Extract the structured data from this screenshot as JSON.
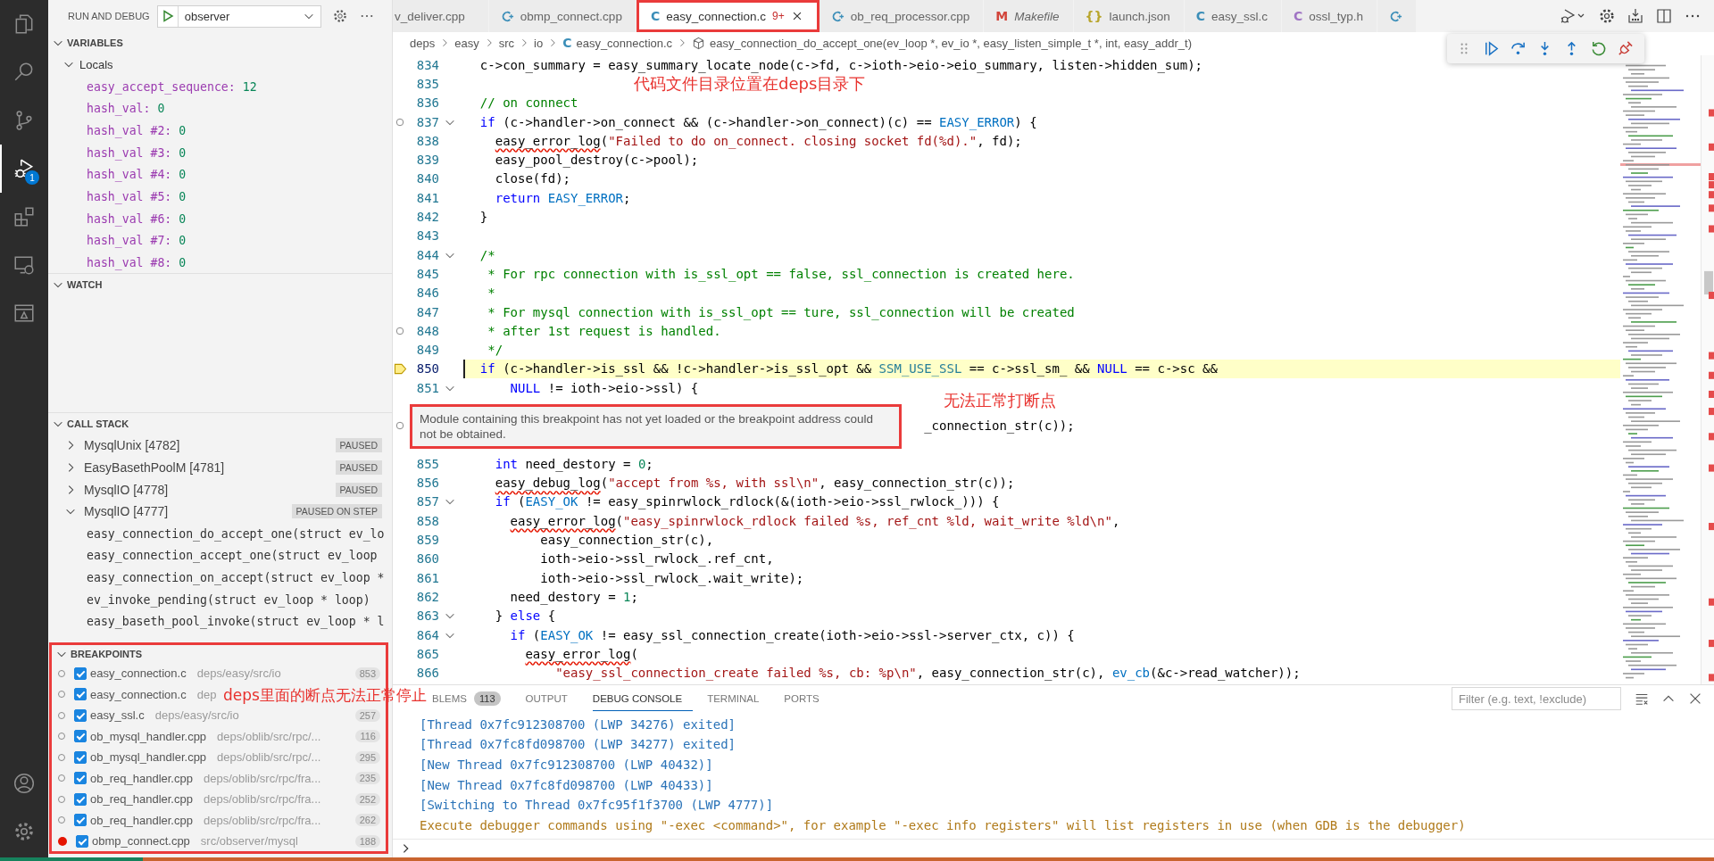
{
  "activity_bar": {
    "items": [
      {
        "kind": "files",
        "selected": false
      },
      {
        "kind": "search",
        "selected": false
      },
      {
        "kind": "source-control",
        "selected": false
      },
      {
        "kind": "debug",
        "selected": true,
        "badge": "1"
      },
      {
        "kind": "extensions",
        "selected": false
      },
      {
        "kind": "remote",
        "selected": false
      },
      {
        "kind": "panel",
        "selected": false
      }
    ],
    "bottom": [
      {
        "kind": "account"
      },
      {
        "kind": "manage"
      }
    ]
  },
  "sidebar": {
    "title": "RUN AND DEBUG",
    "config": "observer",
    "variables": {
      "title": "VARIABLES",
      "expanded": true,
      "scope": {
        "label": "Locals",
        "expanded": true,
        "items": [
          {
            "name": "easy_accept_sequence:",
            "value": "12"
          },
          {
            "name": "hash_val:",
            "value": "0"
          },
          {
            "name": "hash_val #2:",
            "value": "0"
          },
          {
            "name": "hash_val #3:",
            "value": "0"
          },
          {
            "name": "hash_val #4:",
            "value": "0"
          },
          {
            "name": "hash_val #5:",
            "value": "0"
          },
          {
            "name": "hash_val #6:",
            "value": "0"
          },
          {
            "name": "hash_val #7:",
            "value": "0"
          },
          {
            "name": "hash_val #8:",
            "value": "0"
          }
        ]
      }
    },
    "watch": {
      "title": "WATCH",
      "expanded": true
    },
    "call_stack": {
      "title": "CALL STACK",
      "expanded": true,
      "threads": [
        {
          "name": "MysqlUnix [4782]",
          "status": "PAUSED",
          "expanded": false
        },
        {
          "name": "EasyBasethPoolM [4781]",
          "status": "PAUSED",
          "expanded": false
        },
        {
          "name": "MysqlIO [4778]",
          "status": "PAUSED",
          "expanded": false
        },
        {
          "name": "MysqlIO [4777]",
          "status": "PAUSED ON STEP",
          "expanded": true,
          "frames": [
            "easy_connection_do_accept_one(struct ev_lo",
            "easy_connection_accept_one(struct ev_loop",
            "easy_connection_on_accept(struct ev_loop *",
            "ev_invoke_pending(struct ev_loop * loop)",
            "easy_baseth_pool_invoke(struct ev_loop * l"
          ]
        }
      ]
    },
    "breakpoints": {
      "title": "BREAKPOINTS",
      "expanded": true,
      "annotated": true,
      "items": [
        {
          "file": "easy_connection.c",
          "path": "deps/easy/src/io",
          "line": "853",
          "verified": false,
          "checked": true
        },
        {
          "file": "easy_connection.c",
          "path": "dep",
          "verified": false,
          "checked": true
        },
        {
          "file": "easy_ssl.c",
          "path": "deps/easy/src/io",
          "line": "257",
          "verified": false,
          "checked": true
        },
        {
          "file": "ob_mysql_handler.cpp",
          "path": "deps/oblib/src/rpc/...",
          "line": "116",
          "verified": false,
          "checked": true
        },
        {
          "file": "ob_mysql_handler.cpp",
          "path": "deps/oblib/src/rpc/...",
          "line": "295",
          "verified": false,
          "checked": true
        },
        {
          "file": "ob_req_handler.cpp",
          "path": "deps/oblib/src/rpc/fra...",
          "line": "235",
          "verified": false,
          "checked": true
        },
        {
          "file": "ob_req_handler.cpp",
          "path": "deps/oblib/src/rpc/fra...",
          "line": "252",
          "verified": false,
          "checked": true
        },
        {
          "file": "ob_req_handler.cpp",
          "path": "deps/oblib/src/rpc/fra...",
          "line": "262",
          "verified": false,
          "checked": true
        },
        {
          "file": "obmp_connect.cpp",
          "path": "src/observer/mysql",
          "line": "188",
          "verified": true,
          "checked": true
        }
      ]
    }
  },
  "editor": {
    "tabs": [
      {
        "label": "v_deliver.cpp",
        "selected": false,
        "preview": false,
        "annotated": false
      },
      {
        "label": "obmp_connect.cpp",
        "icon": {
          "kind": "cpp"
        },
        "selected": false,
        "preview": false,
        "annotated": false
      },
      {
        "label": "easy_connection.c",
        "icon": {
          "kind": "c",
          "glyph": "C"
        },
        "badge": "9+",
        "selected": true,
        "preview": false,
        "annotated": true
      },
      {
        "label": "ob_req_processor.cpp",
        "icon": {
          "kind": "cpp"
        },
        "selected": false,
        "preview": false,
        "annotated": false
      },
      {
        "label": "Makefile",
        "icon": {
          "kind": "make",
          "glyph": "M"
        },
        "selected": false,
        "preview": true,
        "annotated": false
      },
      {
        "label": "launch.json",
        "icon": {
          "kind": "json",
          "glyph": "{}"
        },
        "selected": false,
        "preview": false,
        "annotated": false
      },
      {
        "label": "easy_ssl.c",
        "icon": {
          "kind": "c",
          "glyph": "C"
        },
        "selected": false,
        "preview": false,
        "annotated": false
      },
      {
        "label": "ossl_typ.h",
        "icon": {
          "kind": "h",
          "glyph": "C"
        },
        "selected": false,
        "preview": false,
        "annotated": false
      },
      {
        "icon": {
          "kind": "cpp"
        },
        "selected": false,
        "annotated": false
      }
    ],
    "actions": [
      {
        "kind": "run-debug"
      },
      {
        "kind": "settings"
      },
      {
        "kind": "tray"
      },
      {
        "kind": "split"
      },
      {
        "kind": "more"
      }
    ],
    "breadcrumb": [
      {
        "label": "deps"
      },
      {
        "label": "easy"
      },
      {
        "label": "src"
      },
      {
        "label": "io"
      },
      {
        "label": "easy_connection.c",
        "icon": {
          "kind": "c",
          "glyph": "C"
        }
      },
      {
        "label": "easy_connection_do_accept_one(ev_loop *, ev_io *, easy_listen_simple_t *, int, easy_addr_t)",
        "icon": {
          "kind": "method"
        }
      }
    ],
    "debug_toolbar": [
      {
        "kind": "grip"
      },
      {
        "kind": "continue"
      },
      {
        "kind": "step-over"
      },
      {
        "kind": "step-into"
      },
      {
        "kind": "step-out"
      },
      {
        "kind": "restart"
      },
      {
        "kind": "disconnect"
      }
    ],
    "lines": [
      {
        "n": "834",
        "breakpoint": false,
        "current": false,
        "fold": false,
        "segments": [
          {
            "kind": "plain",
            "text": "  c->con_summary = easy_summary_locate_node(c->fd, c->ioth->eio->eio_summary, listen->hidden_sum);"
          }
        ]
      },
      {
        "n": "835",
        "breakpoint": false,
        "current": false,
        "fold": false
      },
      {
        "n": "836",
        "breakpoint": false,
        "current": false,
        "fold": false,
        "segments": [
          {
            "kind": "comment",
            "text": "  // on connect"
          }
        ]
      },
      {
        "n": "837",
        "breakpoint": true,
        "current": false,
        "fold": true,
        "segments": [
          {
            "kind": "keyword",
            "text": "  if"
          },
          {
            "kind": "plain",
            "text": " (c->handler->on_connect && (c->handler->on_connect)(c) == "
          },
          {
            "kind": "constant",
            "text": "EASY_ERROR"
          },
          {
            "kind": "plain",
            "text": ") {"
          }
        ]
      },
      {
        "n": "838",
        "breakpoint": false,
        "current": false,
        "fold": false,
        "segments": [
          {
            "kind": "flagged",
            "text": "    easy_error_log"
          },
          {
            "kind": "plain",
            "text": "("
          },
          {
            "kind": "string",
            "text": "\"Failed to do on_connect. closing socket fd(%d).\""
          },
          {
            "kind": "plain",
            "text": ", fd);"
          }
        ]
      },
      {
        "n": "839",
        "breakpoint": false,
        "current": false,
        "fold": false,
        "segments": [
          {
            "kind": "plain",
            "text": "    easy_pool_destroy(c->pool);"
          }
        ]
      },
      {
        "n": "840",
        "breakpoint": false,
        "current": false,
        "fold": false,
        "segments": [
          {
            "kind": "plain",
            "text": "    close(fd);"
          }
        ]
      },
      {
        "n": "841",
        "breakpoint": false,
        "current": false,
        "fold": false,
        "segments": [
          {
            "kind": "keyword",
            "text": "    return"
          },
          {
            "kind": "constant",
            "text": " EASY_ERROR"
          },
          {
            "kind": "plain",
            "text": ";"
          }
        ]
      },
      {
        "n": "842",
        "breakpoint": false,
        "current": false,
        "fold": false,
        "segments": [
          {
            "kind": "plain",
            "text": "  }"
          }
        ]
      },
      {
        "n": "843",
        "breakpoint": false,
        "current": false,
        "fold": false
      },
      {
        "n": "844",
        "breakpoint": false,
        "current": false,
        "fold": true,
        "segments": [
          {
            "kind": "comment",
            "text": "  /*"
          }
        ]
      },
      {
        "n": "845",
        "breakpoint": false,
        "current": false,
        "fold": false,
        "segments": [
          {
            "kind": "comment",
            "text": "   * For rpc connection with is_ssl_opt == false, ssl_connection is created here."
          }
        ]
      },
      {
        "n": "846",
        "breakpoint": false,
        "current": false,
        "fold": false,
        "segments": [
          {
            "kind": "comment",
            "text": "   *"
          }
        ]
      },
      {
        "n": "847",
        "breakpoint": false,
        "current": false,
        "fold": false,
        "segments": [
          {
            "kind": "comment",
            "text": "   * For mysql connection with is_ssl_opt == ture, ssl_connection will be created"
          }
        ]
      },
      {
        "n": "848",
        "breakpoint": true,
        "current": false,
        "fold": false,
        "segments": [
          {
            "kind": "comment",
            "text": "   * after 1st request is handled."
          }
        ]
      },
      {
        "n": "849",
        "breakpoint": false,
        "current": false,
        "fold": false,
        "segments": [
          {
            "kind": "comment",
            "text": "   */"
          }
        ]
      },
      {
        "n": "850",
        "breakpoint": false,
        "current": true,
        "fold": false,
        "segments": [
          {
            "kind": "keyword",
            "text": "  if"
          },
          {
            "kind": "plain",
            "text": " (c->handler->is_ssl && !c->handler->is_ssl_opt && "
          },
          {
            "kind": "type",
            "text": "SSM_USE_SSL"
          },
          {
            "kind": "plain",
            "text": " == c->ssl_sm_ && "
          },
          {
            "kind": "keyword",
            "text": "NULL"
          },
          {
            "kind": "plain",
            "text": " == c->sc &&"
          }
        ]
      },
      {
        "n": "851",
        "breakpoint": false,
        "current": false,
        "fold": true,
        "segments": [
          {
            "kind": "keyword",
            "text": "      NULL"
          },
          {
            "kind": "plain",
            "text": " != ioth->eio->ssl) {"
          }
        ]
      },
      {
        "breakpoint": false,
        "current": false,
        "fold": false
      },
      {
        "breakpoint": true,
        "current": false,
        "fold": false,
        "segments": [
          {
            "kind": "plain",
            "text": "                                                             _connection_str(c));"
          }
        ]
      },
      {
        "breakpoint": false,
        "current": false,
        "fold": false
      },
      {
        "n": "855",
        "breakpoint": false,
        "current": false,
        "fold": false,
        "segments": [
          {
            "kind": "keyword",
            "text": "    int"
          },
          {
            "kind": "plain",
            "text": " need_destory = "
          },
          {
            "kind": "number",
            "text": "0"
          },
          {
            "kind": "plain",
            "text": ";"
          }
        ]
      },
      {
        "n": "856",
        "breakpoint": false,
        "current": false,
        "fold": false,
        "segments": [
          {
            "kind": "flagged",
            "text": "    easy_debug_log"
          },
          {
            "kind": "plain",
            "text": "("
          },
          {
            "kind": "string",
            "text": "\"accept from %s, with ssl\\n\""
          },
          {
            "kind": "plain",
            "text": ", easy_connection_str(c));"
          }
        ]
      },
      {
        "n": "857",
        "breakpoint": false,
        "current": false,
        "fold": true,
        "segments": [
          {
            "kind": "keyword",
            "text": "    if"
          },
          {
            "kind": "plain",
            "text": " ("
          },
          {
            "kind": "constant",
            "text": "EASY_OK"
          },
          {
            "kind": "plain",
            "text": " != easy_spinrwlock_rdlock(&(ioth->eio->ssl_rwlock_))) {"
          }
        ]
      },
      {
        "n": "858",
        "breakpoint": false,
        "current": false,
        "fold": false,
        "segments": [
          {
            "kind": "flagged",
            "text": "      easy_error_log"
          },
          {
            "kind": "plain",
            "text": "("
          },
          {
            "kind": "string",
            "text": "\"easy_spinrwlock_rdlock failed %s, ref_cnt %ld, wait_write %ld\\n\""
          },
          {
            "kind": "plain",
            "text": ","
          }
        ]
      },
      {
        "n": "859",
        "breakpoint": false,
        "current": false,
        "fold": false,
        "segments": [
          {
            "kind": "plain",
            "text": "          easy_connection_str(c),"
          }
        ]
      },
      {
        "n": "860",
        "breakpoint": false,
        "current": false,
        "fold": false,
        "segments": [
          {
            "kind": "plain",
            "text": "          ioth->eio->ssl_rwlock_.ref_cnt,"
          }
        ]
      },
      {
        "n": "861",
        "breakpoint": false,
        "current": false,
        "fold": false,
        "segments": [
          {
            "kind": "plain",
            "text": "          ioth->eio->ssl_rwlock_.wait_write);"
          }
        ]
      },
      {
        "n": "862",
        "breakpoint": false,
        "current": false,
        "fold": false,
        "segments": [
          {
            "kind": "plain",
            "text": "      need_destory = "
          },
          {
            "kind": "number",
            "text": "1"
          },
          {
            "kind": "plain",
            "text": ";"
          }
        ]
      },
      {
        "n": "863",
        "breakpoint": false,
        "current": false,
        "fold": true,
        "segments": [
          {
            "kind": "plain",
            "text": "    } "
          },
          {
            "kind": "keyword",
            "text": "else"
          },
          {
            "kind": "plain",
            "text": " {"
          }
        ]
      },
      {
        "n": "864",
        "breakpoint": false,
        "current": false,
        "fold": true,
        "segments": [
          {
            "kind": "keyword",
            "text": "      if"
          },
          {
            "kind": "plain",
            "text": " ("
          },
          {
            "kind": "constant",
            "text": "EASY_OK"
          },
          {
            "kind": "plain",
            "text": " != easy_ssl_connection_create(ioth->eio->ssl->server_ctx, c)) {"
          }
        ]
      },
      {
        "n": "865",
        "breakpoint": false,
        "current": false,
        "fold": false,
        "segments": [
          {
            "kind": "flagged",
            "text": "        easy_error_log"
          },
          {
            "kind": "plain",
            "text": "("
          }
        ]
      },
      {
        "n": "866",
        "breakpoint": false,
        "current": false,
        "fold": false,
        "segments": [
          {
            "kind": "string",
            "text": "            \"easy_ssl_connection_create failed %s, cb: %p\\n\""
          },
          {
            "kind": "plain",
            "text": ", easy_connection_str(c), "
          },
          {
            "kind": "constant",
            "text": "ev_cb"
          },
          {
            "kind": "plain",
            "text": "(&c->read_watcher));"
          }
        ]
      }
    ],
    "tooltip": {
      "text": "Module containing this breakpoint has not yet loaded or the breakpoint address could not be obtained.",
      "annotated": true
    }
  },
  "panel": {
    "tabs": [
      {
        "label": "BLEMS",
        "badge": "113",
        "selected": false
      },
      {
        "label": "OUTPUT",
        "selected": false
      },
      {
        "label": "DEBUG CONSOLE",
        "selected": true
      },
      {
        "label": "TERMINAL",
        "selected": false
      },
      {
        "label": "PORTS",
        "selected": false
      }
    ],
    "filter": {
      "placeholder": "Filter (e.g. text, !exclude)"
    },
    "console": [
      {
        "kind": "info",
        "text": "[Thread 0x7fc912308700 (LWP 34276) exited]"
      },
      {
        "kind": "info",
        "text": "[Thread 0x7fc8fd098700 (LWP 34277) exited]"
      },
      {
        "kind": "info",
        "text": "[New Thread 0x7fc912308700 (LWP 40432)]"
      },
      {
        "kind": "info",
        "text": "[New Thread 0x7fc8fd098700 (LWP 40433)]"
      },
      {
        "kind": "info",
        "text": "[Switching to Thread 0x7fc95f1f3700 (LWP 4777)]"
      },
      {
        "kind": "warning",
        "text": "Execute debugger commands using \"-exec <command>\", for example \"-exec info registers\" will list registers in use (when GDB is the debugger)"
      }
    ]
  },
  "annotations": [
    {
      "text": "代码文件目录位置在deps目录下"
    },
    {
      "text": "无法正常打断点"
    },
    {
      "text": "deps里面的断点无法正常停止"
    }
  ]
}
